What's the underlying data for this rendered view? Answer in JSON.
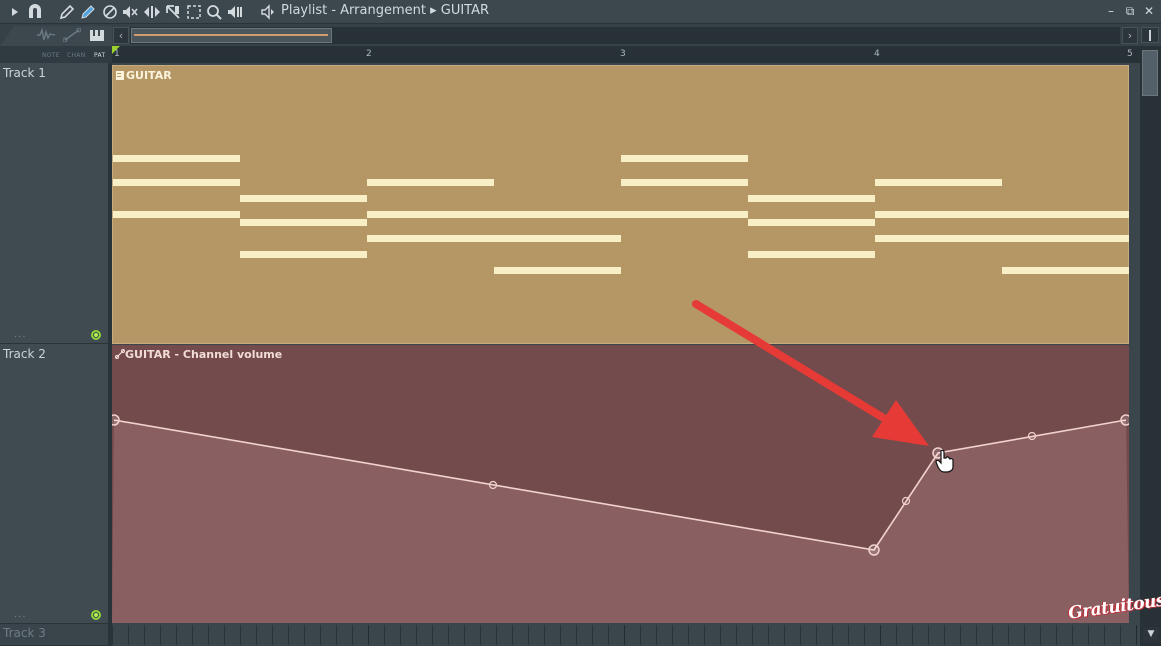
{
  "titlebar": {
    "breadcrumb": "Playlist - Arrangement ▸ GUITAR",
    "tools": [
      "play-arrow-icon",
      "magnet-icon",
      "pencil-icon",
      "paint-brush-icon",
      "delete-icon",
      "mute-icon",
      "slip-icon",
      "slice-icon",
      "select-icon",
      "zoom-icon",
      "playback-icon"
    ],
    "window_buttons": {
      "minimize": "–",
      "restore": "⧉",
      "close": "✕"
    }
  },
  "mode_tabs": {
    "note": "NOTE",
    "chan": "CHAN",
    "pat": "PAT",
    "active": "PAT"
  },
  "ruler": {
    "bars": [
      "1",
      "2",
      "3",
      "4",
      "5"
    ]
  },
  "tracks": [
    {
      "name": "Track 1",
      "dots": "..."
    },
    {
      "name": "Track 2",
      "dots": "..."
    },
    {
      "name": "Track 3"
    }
  ],
  "pattern_clip": {
    "title": "GUITAR",
    "color": "#b59766",
    "note_color": "#f8efc6"
  },
  "automation_clip": {
    "title": "GUITAR - Channel volume",
    "color": "#744b4c",
    "fill_color": "#8a5f61",
    "line_color": "#f1d2cf"
  },
  "annotation": {
    "arrow_color": "#e53a35"
  },
  "watermark": "Gratuitous"
}
